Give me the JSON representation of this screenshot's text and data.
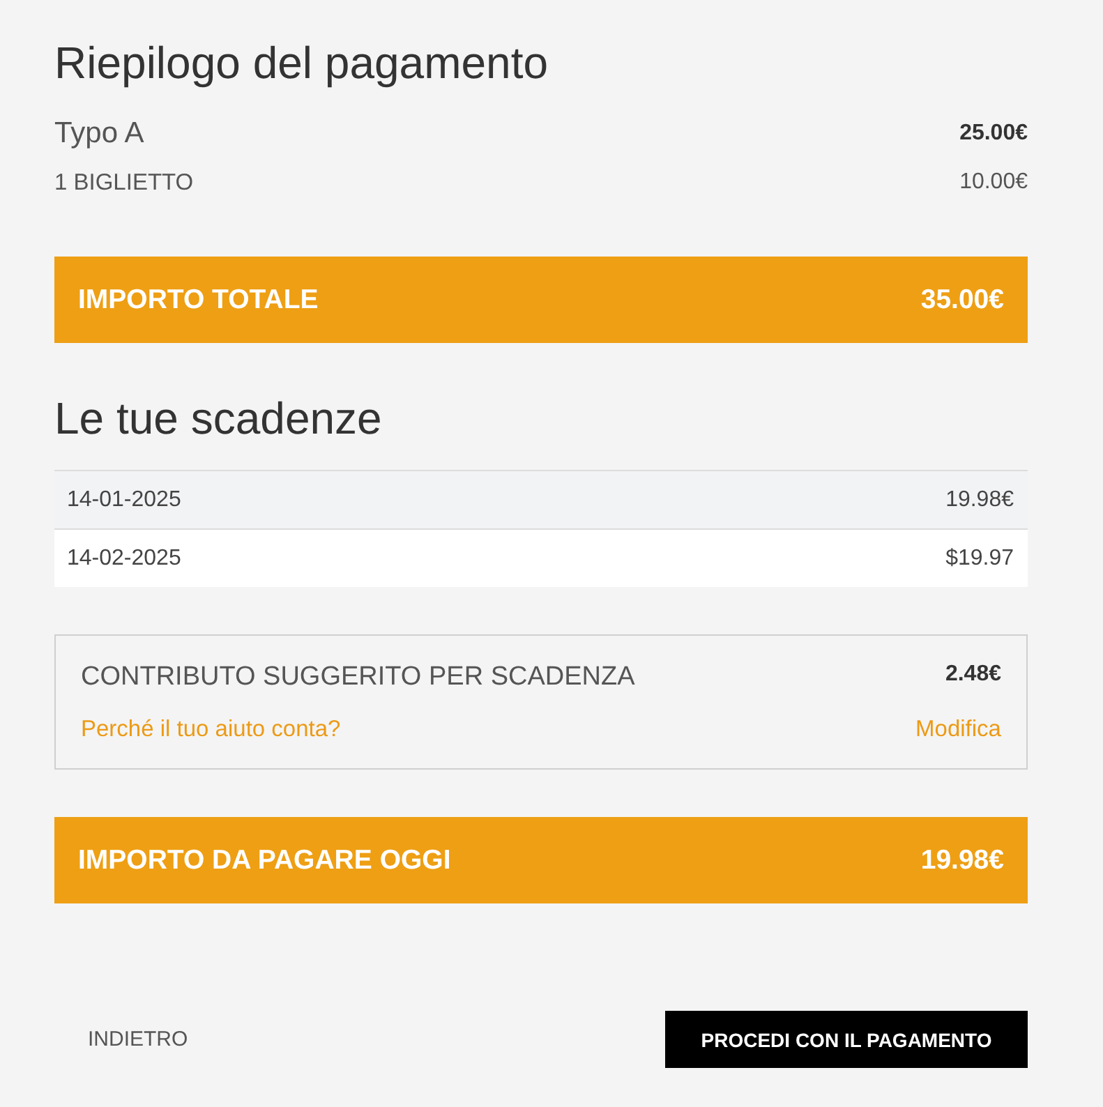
{
  "summary": {
    "title": "Riepilogo del pagamento",
    "items": [
      {
        "kind": "type",
        "label": "Typo A",
        "amount": "25.00€"
      },
      {
        "kind": "ticket",
        "label": "1 BIGLIETTO",
        "amount": "10.00€"
      }
    ],
    "total": {
      "label": "IMPORTO TOTALE",
      "amount": "35.00€"
    }
  },
  "installments": {
    "title": "Le tue scadenze",
    "rows": [
      {
        "date": "14-01-2025",
        "amount": "19.98€"
      },
      {
        "date": "14-02-2025",
        "amount": "$19.97"
      }
    ]
  },
  "contribution": {
    "label": "CONTRIBUTO SUGGERITO PER SCADENZA",
    "amount": "2.48€",
    "info_link": "Perché il tuo aiuto conta?",
    "edit_link": "Modifica"
  },
  "due_today": {
    "label": "IMPORTO DA PAGARE OGGI",
    "amount": "19.98€"
  },
  "buttons": [
    {
      "kind": "secondary",
      "label": "INDIETRO"
    },
    {
      "kind": "primary",
      "label": "PROCEDI CON IL PAGAMENTO"
    }
  ]
}
